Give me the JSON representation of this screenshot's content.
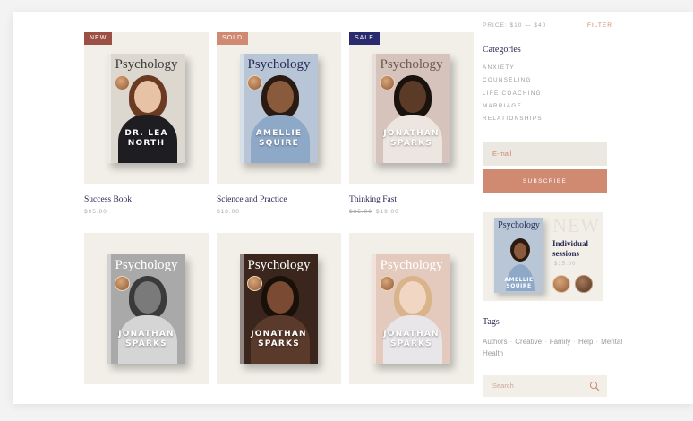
{
  "products": [
    {
      "badge": "NEW",
      "badge_color": "#9b4f45",
      "book_title": "Psychology",
      "author": "DR. LEA NORTH",
      "name": "Success Book",
      "price": "$95.00",
      "old_price": "",
      "cover_bg": "#ddd8cf",
      "title_color": "#3c3c3c",
      "skin": "#e8c2a4",
      "hair": "#6b3a22",
      "body": "#1e1e22"
    },
    {
      "badge": "SOLD",
      "badge_color": "#d08a72",
      "book_title": "Psychology",
      "author": "AMELLIE SQUIRE",
      "name": "Science and Practice",
      "price": "$18.00",
      "old_price": "",
      "cover_bg": "#b7c5d6",
      "title_color": "#2a2a55",
      "skin": "#8a5a3c",
      "hair": "#2a1a12",
      "body": "#8ea8c8"
    },
    {
      "badge": "SALE",
      "badge_color": "#2a2a6e",
      "book_title": "Psychology",
      "author": "JONATHAN SPARKS",
      "name": "Thinking Fast",
      "price": "$19.00",
      "old_price": "$25.00",
      "cover_bg": "#d6c3bb",
      "title_color": "#6b5a55",
      "skin": "#5c3a28",
      "hair": "#1a120c",
      "body": "#ede6e0"
    },
    {
      "badge": "",
      "badge_color": "",
      "book_title": "Psychology",
      "author": "JONATHAN SPARKS",
      "name": "",
      "price": "",
      "old_price": "",
      "cover_bg": "#a9a9a9",
      "title_color": "#ffffff",
      "skin": "#7a7a7a",
      "hair": "#3a3a3a",
      "body": "#d5d5d5"
    },
    {
      "badge": "",
      "badge_color": "",
      "book_title": "Psychology",
      "author": "JONATHAN SPARKS",
      "name": "",
      "price": "",
      "old_price": "",
      "cover_bg": "#3a261c",
      "title_color": "#ffffff",
      "skin": "#7a4a32",
      "hair": "#1a100a",
      "body": "#5a3a2a"
    },
    {
      "badge": "",
      "badge_color": "",
      "book_title": "Psychology",
      "author": "JONATHAN SPARKS",
      "name": "",
      "price": "",
      "old_price": "",
      "cover_bg": "#e4c9bd",
      "title_color": "#ffffff",
      "skin": "#f1d6c4",
      "hair": "#d9b48a",
      "body": "#e8e6e8"
    }
  ],
  "filter": {
    "price_range": "PRICE: $10 — $40",
    "link": "FILTER"
  },
  "categories": {
    "heading": "Categories",
    "items": [
      "ANXIETY",
      "COUNSELING",
      "LIFE COACHING",
      "MARRIAGE",
      "RELATIONSHIPS"
    ]
  },
  "newsletter": {
    "email_placeholder": "E-mail",
    "button": "SUBSCRIBE"
  },
  "promo": {
    "book_title": "Psychology",
    "author": "AMELLIE SQUIRE",
    "new_label": "NEW",
    "title": "Individual sessions",
    "price": "$15.00"
  },
  "tags": {
    "heading": "Tags",
    "items": [
      "Authors",
      "Creative",
      "Family",
      "Help",
      "Mental Health"
    ]
  },
  "search": {
    "placeholder": "Search"
  }
}
